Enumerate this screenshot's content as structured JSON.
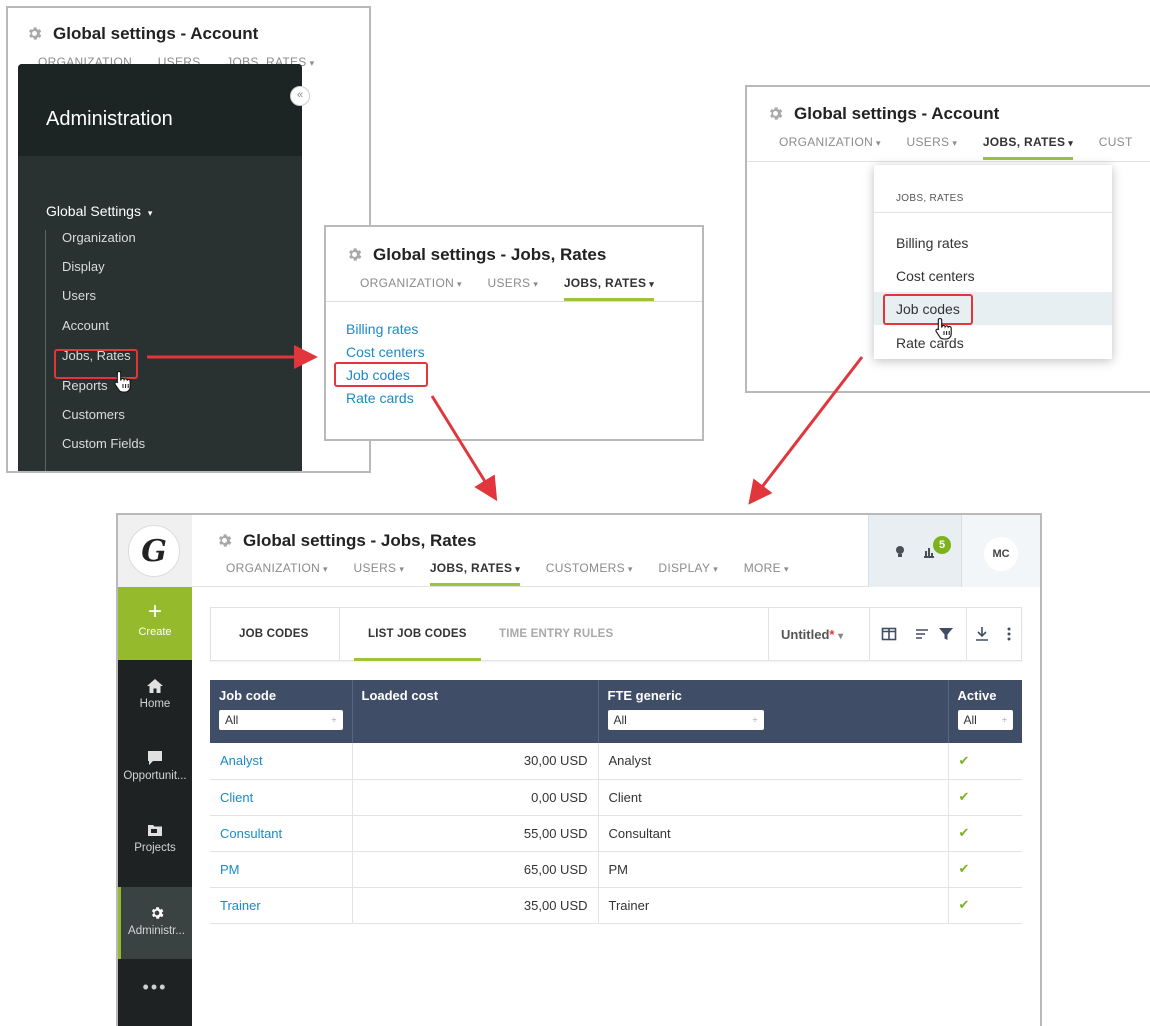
{
  "panel1": {
    "title": "Global settings - Account",
    "tabs": [
      {
        "label": "ORGANIZATION"
      },
      {
        "label": "USERS"
      },
      {
        "label": "JOBS, RATES"
      }
    ],
    "sidebar": {
      "heading": "Administration",
      "collapse": "«",
      "section": "Global Settings",
      "section_caret": "▾",
      "items": [
        "Organization",
        "Display",
        "Users",
        "Account",
        "Jobs, Rates",
        "Reports",
        "Customers",
        "Custom Fields"
      ]
    }
  },
  "panel2": {
    "title": "Global settings - Jobs, Rates",
    "tabs": [
      {
        "label": "ORGANIZATION"
      },
      {
        "label": "USERS"
      },
      {
        "label": "JOBS, RATES"
      }
    ],
    "links": [
      "Billing rates",
      "Cost centers",
      "Job codes",
      "Rate cards"
    ]
  },
  "panel3": {
    "title": "Global settings - Account",
    "tabs": [
      {
        "label": "ORGANIZATION"
      },
      {
        "label": "USERS"
      },
      {
        "label": "JOBS, RATES"
      },
      {
        "label": "CUST"
      }
    ],
    "dropdown": {
      "heading": "JOBS, RATES",
      "items": [
        "Billing rates",
        "Cost centers",
        "Job codes",
        "Rate cards"
      ]
    }
  },
  "panel4": {
    "logo": "G",
    "title": "Global settings - Jobs, Rates",
    "tabs": [
      {
        "label": "ORGANIZATION"
      },
      {
        "label": "USERS"
      },
      {
        "label": "JOBS, RATES"
      },
      {
        "label": "CUSTOMERS"
      },
      {
        "label": "DISPLAY"
      },
      {
        "label": "MORE"
      }
    ],
    "caret": "▾",
    "badge": "5",
    "avatar": "MC",
    "nav": {
      "create": "Create",
      "home": "Home",
      "opportunities": "Opportunit...",
      "projects": "Projects",
      "administration": "Administr...",
      "more": "•••"
    },
    "subtabs": {
      "job_codes": "JOB CODES",
      "list_job_codes": "LIST JOB CODES",
      "time_entry_rules": "TIME ENTRY RULES"
    },
    "view": {
      "name": "Untitled",
      "modified": "*",
      "caret": "▾"
    },
    "table": {
      "headers": {
        "job_code": "Job code",
        "loaded_cost": "Loaded cost",
        "fte_generic": "FTE generic",
        "active": "Active"
      },
      "filters": {
        "job_code": "All",
        "fte_generic": "All",
        "active": "All"
      },
      "filter_arrow": "÷",
      "rows": [
        {
          "code": "Analyst",
          "cost": "30,00 USD",
          "fte": "Analyst",
          "active": "✔"
        },
        {
          "code": "Client",
          "cost": "0,00 USD",
          "fte": "Client",
          "active": "✔"
        },
        {
          "code": "Consultant",
          "cost": "55,00 USD",
          "fte": "Consultant",
          "active": "✔"
        },
        {
          "code": "PM",
          "cost": "65,00 USD",
          "fte": "PM",
          "active": "✔"
        },
        {
          "code": "Trainer",
          "cost": "35,00 USD",
          "fte": "Trainer",
          "active": "✔"
        }
      ]
    }
  },
  "colors": {
    "accent_green": "#95bb2d",
    "link_blue": "#1a8ac6",
    "highlight_red": "#e1373c",
    "header_navy": "#3f4e66"
  }
}
